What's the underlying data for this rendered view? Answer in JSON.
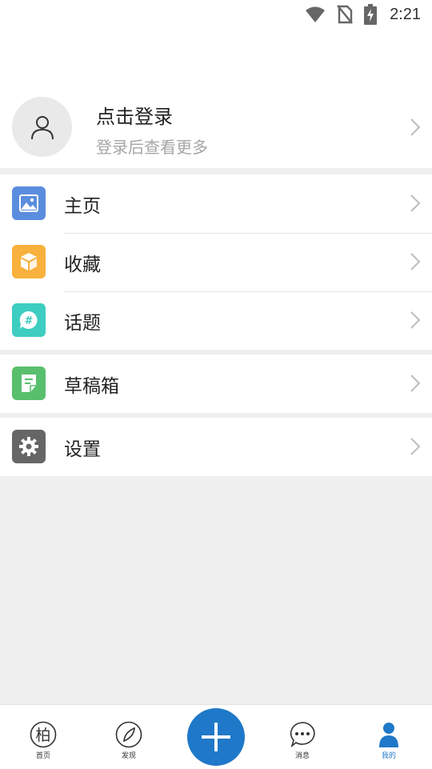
{
  "status_bar": {
    "time": "2:21",
    "icons": [
      "wifi-icon",
      "no-sim-icon",
      "battery-charging-icon"
    ]
  },
  "profile": {
    "title": "点击登录",
    "subtitle": "登录后查看更多",
    "avatar_icon": "user-icon"
  },
  "menu": {
    "group1": [
      {
        "label": "主页",
        "icon": "image-icon",
        "color": "#5b8dde"
      },
      {
        "label": "收藏",
        "icon": "box-icon",
        "color": "#f8b13c"
      },
      {
        "label": "话题",
        "icon": "hashtag-chat-icon",
        "color": "#3ecdc1"
      }
    ],
    "group2": [
      {
        "label": "草稿箱",
        "icon": "draft-icon",
        "color": "#58bf6d"
      }
    ],
    "group3": [
      {
        "label": "设置",
        "icon": "gear-icon",
        "color": "#666666"
      }
    ]
  },
  "bottom_nav": {
    "items": [
      {
        "label": "首页",
        "icon": "bai-logo-icon"
      },
      {
        "label": "发现",
        "icon": "compass-icon"
      },
      {
        "label": "消息",
        "icon": "chat-bubble-icon"
      },
      {
        "label": "我的",
        "icon": "person-icon",
        "active": true
      }
    ],
    "fab_icon": "plus-icon",
    "fab_color": "#1f78c8",
    "active_color": "#1f78c8"
  }
}
